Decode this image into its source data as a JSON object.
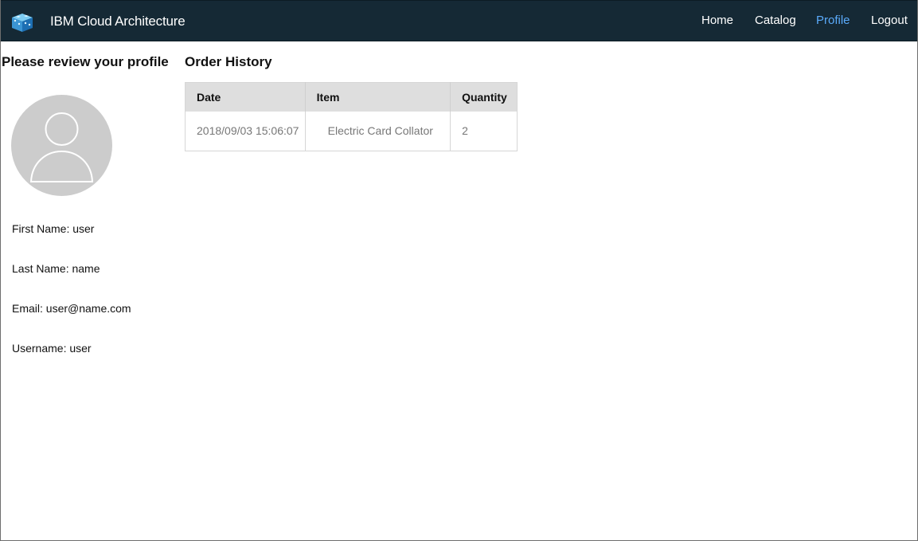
{
  "navbar": {
    "brand": "IBM Cloud Architecture",
    "logo_icon": "blue-cube-logo-icon",
    "background": "#152935",
    "active_color": "#5aaafa",
    "links": [
      {
        "label": "Home",
        "active": false
      },
      {
        "label": "Catalog",
        "active": false
      },
      {
        "label": "Profile",
        "active": true
      },
      {
        "label": "Logout",
        "active": false
      }
    ]
  },
  "profile": {
    "title": "Please review your profile",
    "avatar_icon": "user-avatar-icon",
    "fields": [
      {
        "label": "First Name",
        "value": "user",
        "text": "First Name: user"
      },
      {
        "label": "Last Name",
        "value": "name",
        "text": "Last Name: name"
      },
      {
        "label": "Email",
        "value": "user@name.com",
        "text": "Email: user@name.com"
      },
      {
        "label": "Username",
        "value": "user",
        "text": "Username: user"
      }
    ]
  },
  "orders": {
    "title": "Order History",
    "columns": [
      "Date",
      "Item",
      "Quantity"
    ],
    "rows": [
      {
        "date": "2018/09/03 15:06:07",
        "item": "Electric Card Collator",
        "quantity": "2"
      }
    ]
  }
}
